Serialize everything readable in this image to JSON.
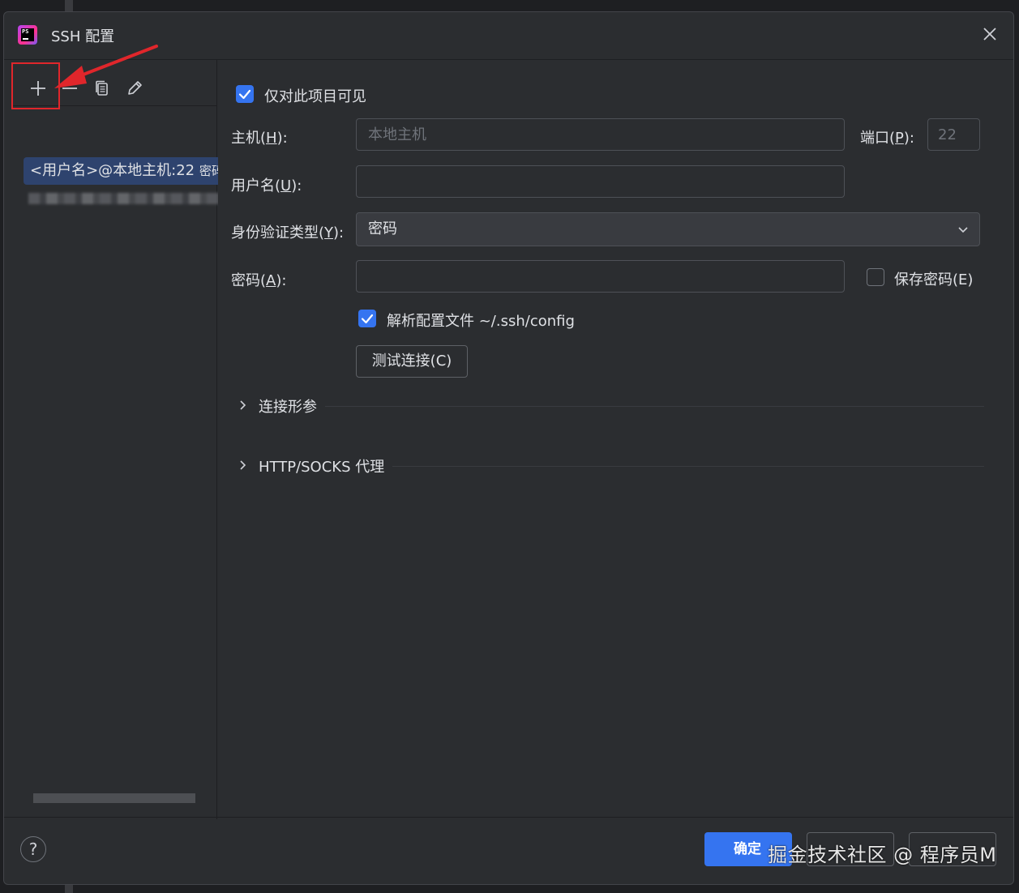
{
  "window": {
    "title": "SSH 配置",
    "app_icon_text": "PS",
    "accent": "#3574f0"
  },
  "toolbar": {
    "add": "plus-icon",
    "remove": "minus-icon",
    "copy": "copy-icon",
    "edit": "edit-icon"
  },
  "list": {
    "items": [
      {
        "label": "<用户名>@本地主机:22",
        "suffix": "密码",
        "selected": true
      },
      {
        "label": "",
        "suffix": "",
        "selected": false,
        "obscured": true
      }
    ]
  },
  "form": {
    "visible_only": {
      "label": "仅对此项目可见",
      "checked": true
    },
    "host": {
      "label_pre": "主机(",
      "mnemonic": "H",
      "label_post": "):",
      "value": "",
      "placeholder": "本地主机"
    },
    "port": {
      "label_pre": "端口(",
      "mnemonic": "P",
      "label_post": "):",
      "value": "",
      "placeholder": "22"
    },
    "username": {
      "label_pre": "用户名(",
      "mnemonic": "U",
      "label_post": "):",
      "value": ""
    },
    "auth_type": {
      "label_pre": "身份验证类型(",
      "mnemonic": "Y",
      "label_post": "):",
      "value": "密码"
    },
    "password": {
      "label_pre": "密码(",
      "mnemonic": "A",
      "label_post": "):",
      "value": ""
    },
    "save_password": {
      "label": "保存密码(E)",
      "checked": false
    },
    "parse_config": {
      "label": "解析配置文件 ~/.ssh/config",
      "checked": true
    },
    "test_connection": "测试连接(C)",
    "sections": [
      "连接形参",
      "HTTP/SOCKS 代理"
    ]
  },
  "footer": {
    "help": "?",
    "ok": "确定",
    "cancel": "",
    "apply": "",
    "watermark": "掘金技术社区 @ 程序员M"
  }
}
